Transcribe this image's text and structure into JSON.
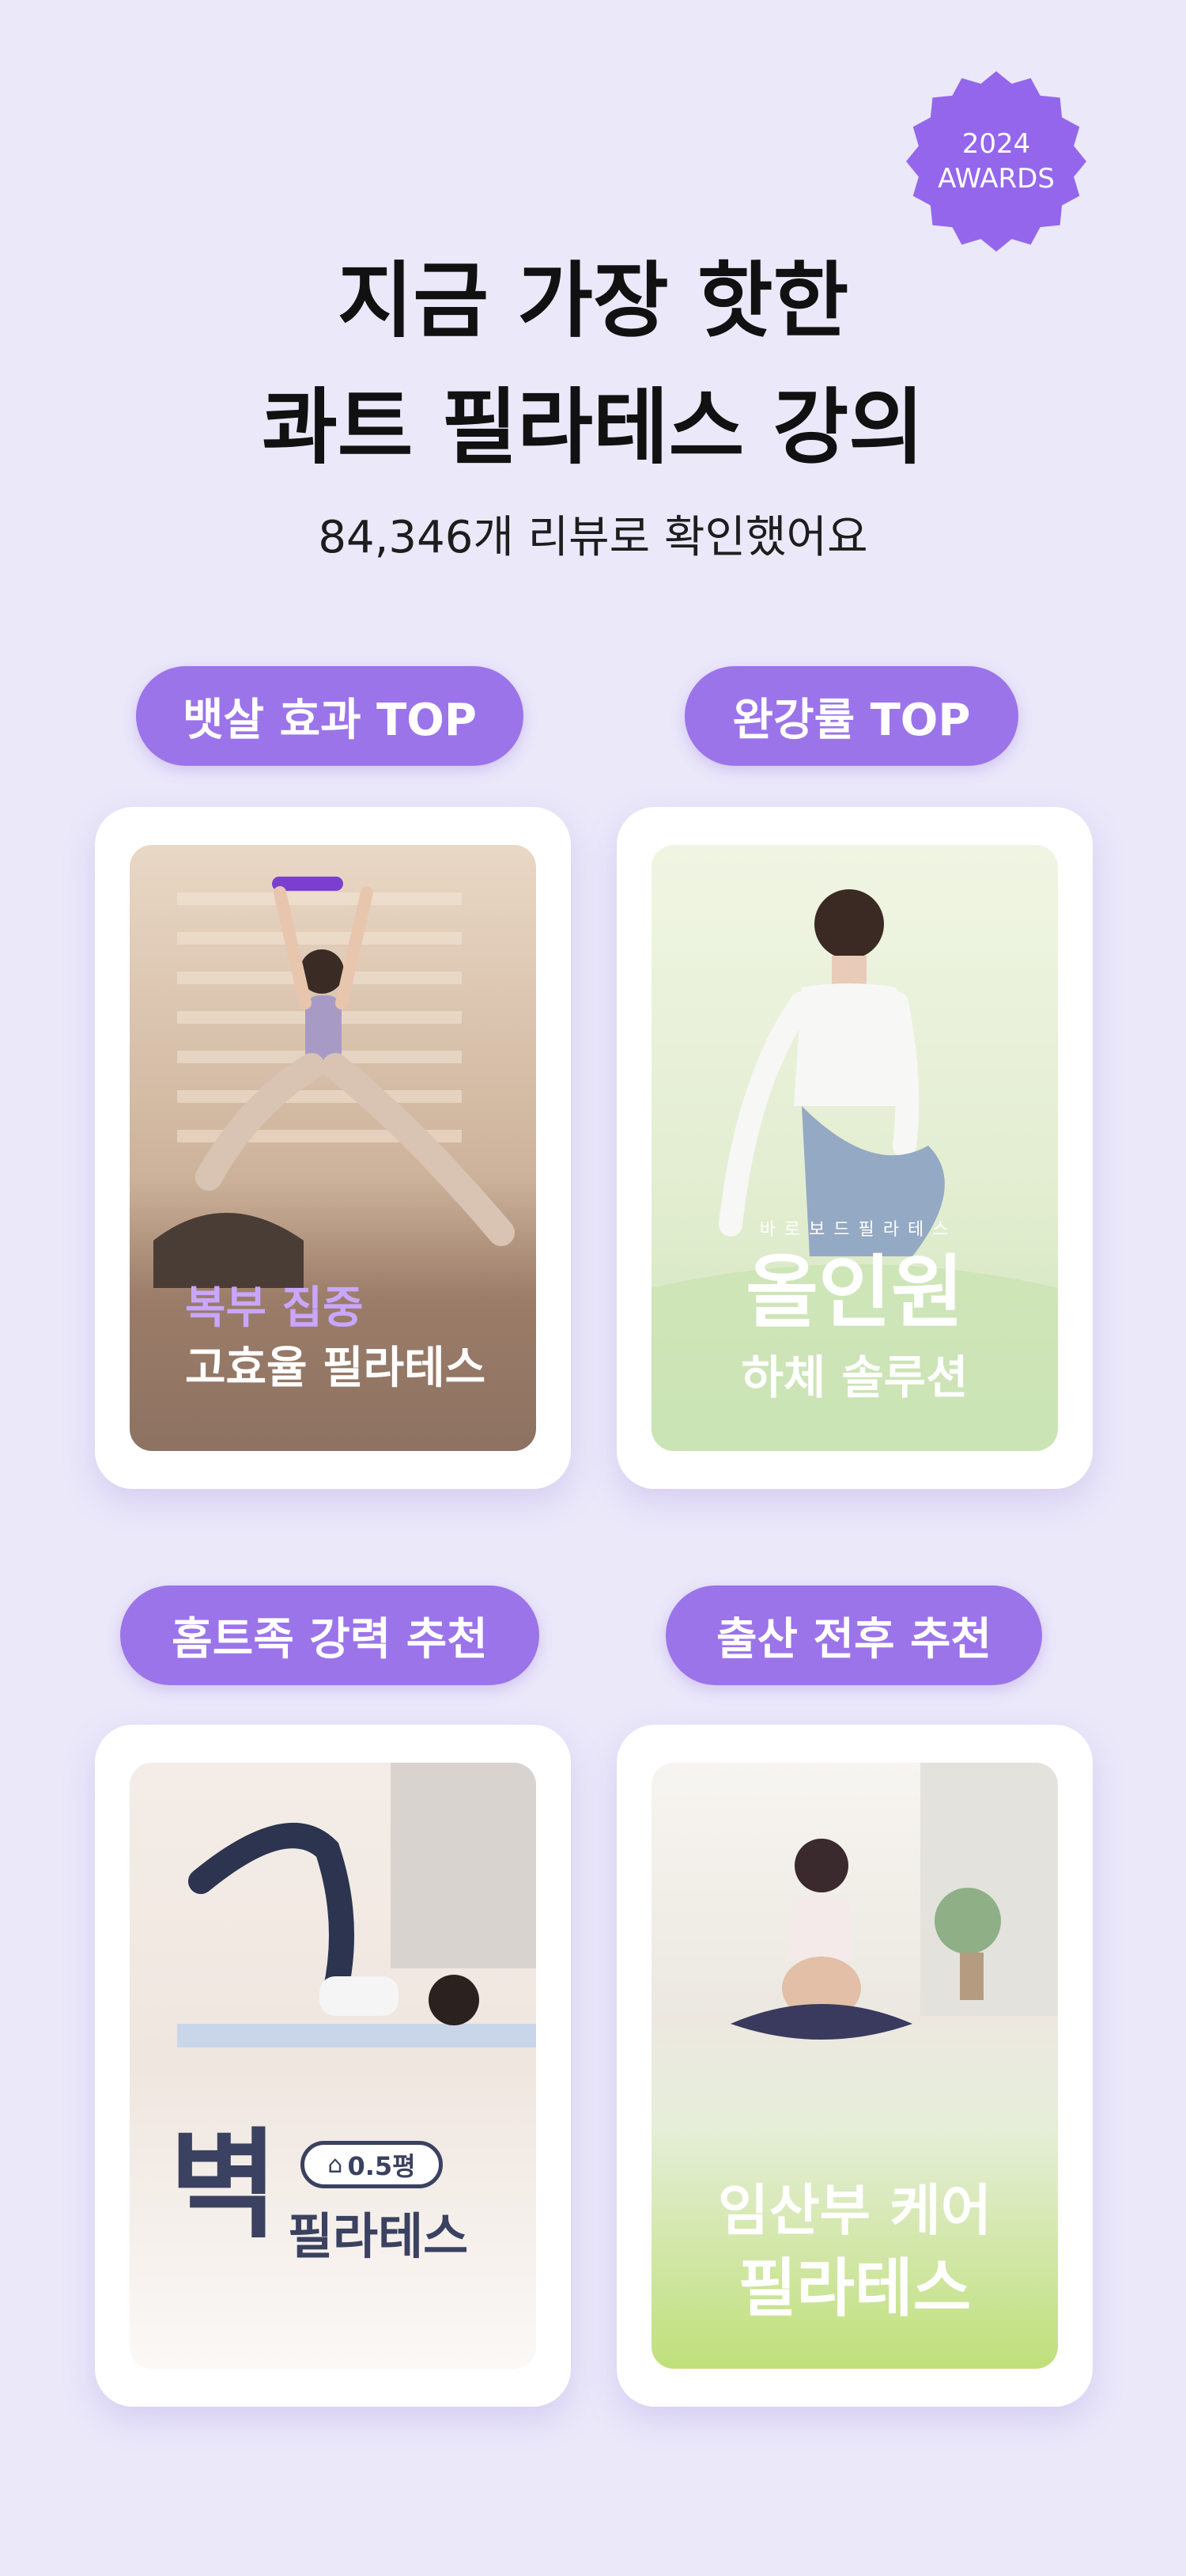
{
  "badge": {
    "year": "2024",
    "label": "AWARDS"
  },
  "header": {
    "title_line1": "지금 가장 핫한",
    "title_line2": "콰트 필라테스 강의",
    "subtitle": "84,346개 리뷰로 확인했어요"
  },
  "categories": [
    {
      "tag": "뱃살 효과 TOP",
      "caption_line1": "복부 집중",
      "caption_line2": "고효율 필라테스"
    },
    {
      "tag": "완강률 TOP",
      "caption_small": "바 로 보 드  필 라 테 스",
      "caption_line1": "올인원",
      "caption_line2": "하체 솔루션"
    },
    {
      "tag": "홈트족 강력 추천",
      "caption_big": "벽",
      "caption_chip": "0.5평",
      "caption_line2": "필라테스"
    },
    {
      "tag": "출산 전후 추천",
      "caption_line1": "임산부 케어",
      "caption_line2": "필라테스"
    }
  ],
  "colors": {
    "background": "#ebe8fa",
    "accent": "#9b74ea",
    "badge": "#9466ec"
  }
}
